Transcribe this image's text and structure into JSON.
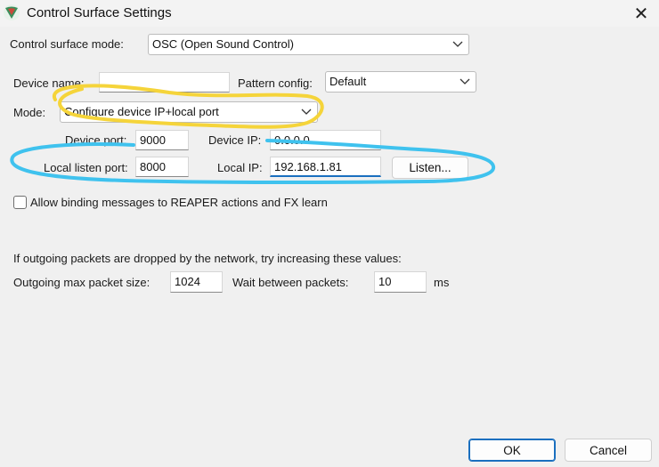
{
  "window": {
    "title": "Control Surface Settings",
    "close_glyph": "✕"
  },
  "surface_mode": {
    "label": "Control surface mode:",
    "value": "OSC (Open Sound Control)"
  },
  "device_name": {
    "label": "Device name:",
    "value": ""
  },
  "pattern_config": {
    "label": "Pattern config:",
    "value": "Default"
  },
  "mode": {
    "label": "Mode:",
    "value": "Configure device IP+local port"
  },
  "device_port": {
    "label": "Device port:",
    "value": "9000"
  },
  "device_ip": {
    "label": "Device IP:",
    "value": "0.0.0.0"
  },
  "local_listen_port": {
    "label": "Local listen port:",
    "value": "8000"
  },
  "local_ip": {
    "label": "Local IP:",
    "value": "192.168.1.81"
  },
  "listen_button": {
    "label": "Listen..."
  },
  "allow_binding": {
    "label": "Allow binding messages to REAPER actions and FX learn",
    "checked": false
  },
  "packets": {
    "note": "If outgoing packets are dropped by the network, try increasing these values:",
    "max_size_label": "Outgoing max packet size:",
    "max_size_value": "1024",
    "wait_label": "Wait between packets:",
    "wait_value": "10",
    "wait_unit": "ms"
  },
  "footer": {
    "ok": "OK",
    "cancel": "Cancel"
  },
  "annotations": {
    "yellow_color": "#f5d43a",
    "blue_color": "#3fc2ee"
  }
}
